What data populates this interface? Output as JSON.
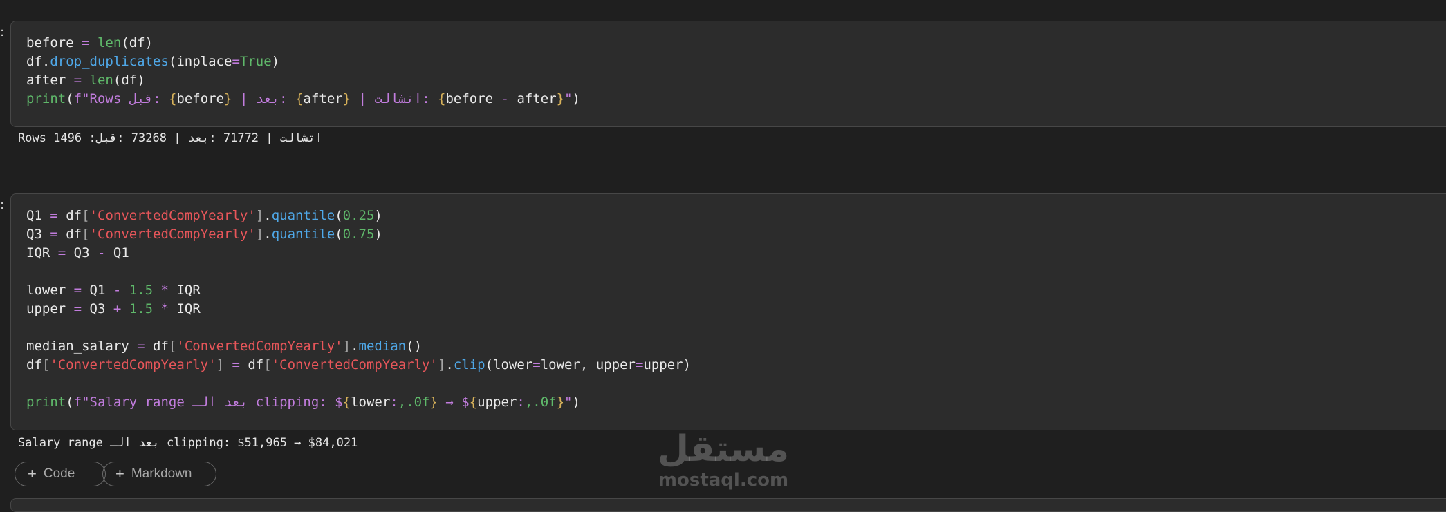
{
  "gutter_mark": ":",
  "cell1": {
    "lines": [
      [
        {
          "c": "n",
          "t": "before "
        },
        {
          "c": "op",
          "t": "="
        },
        {
          "c": "n",
          "t": " "
        },
        {
          "c": "b",
          "t": "len"
        },
        {
          "c": "n",
          "t": "(df)"
        }
      ],
      [
        {
          "c": "n",
          "t": "df."
        },
        {
          "c": "f",
          "t": "drop_duplicates"
        },
        {
          "c": "n",
          "t": "(inplace"
        },
        {
          "c": "op",
          "t": "="
        },
        {
          "c": "b",
          "t": "True"
        },
        {
          "c": "n",
          "t": ")"
        }
      ],
      [
        {
          "c": "n",
          "t": "after "
        },
        {
          "c": "op",
          "t": "="
        },
        {
          "c": "n",
          "t": " "
        },
        {
          "c": "b",
          "t": "len"
        },
        {
          "c": "n",
          "t": "(df)"
        }
      ],
      [
        {
          "c": "b",
          "t": "print"
        },
        {
          "c": "n",
          "t": "("
        },
        {
          "c": "fs",
          "t": "f\"Rows قبل: "
        },
        {
          "c": "br",
          "t": "{"
        },
        {
          "c": "n",
          "t": "before"
        },
        {
          "c": "br",
          "t": "}"
        },
        {
          "c": "fs",
          "t": " | بعد: "
        },
        {
          "c": "br",
          "t": "{"
        },
        {
          "c": "n",
          "t": "after"
        },
        {
          "c": "br",
          "t": "}"
        },
        {
          "c": "fs",
          "t": " | اتشالت: "
        },
        {
          "c": "br",
          "t": "{"
        },
        {
          "c": "n",
          "t": "before "
        },
        {
          "c": "op",
          "t": "-"
        },
        {
          "c": "n",
          "t": " after"
        },
        {
          "c": "br",
          "t": "}"
        },
        {
          "c": "fs",
          "t": "\""
        },
        {
          "c": "n",
          "t": ")"
        }
      ]
    ],
    "output": "Rows 1496 :اتشالت | 71772 :بعد | 73268 :قبل"
  },
  "cell2": {
    "lines": [
      [
        {
          "c": "n",
          "t": "Q1 "
        },
        {
          "c": "op",
          "t": "="
        },
        {
          "c": "n",
          "t": " df"
        },
        {
          "c": "brp",
          "t": "["
        },
        {
          "c": "s",
          "t": "'ConvertedCompYearly'"
        },
        {
          "c": "brp",
          "t": "]"
        },
        {
          "c": "n",
          "t": "."
        },
        {
          "c": "f",
          "t": "quantile"
        },
        {
          "c": "n",
          "t": "("
        },
        {
          "c": "num",
          "t": "0.25"
        },
        {
          "c": "n",
          "t": ")"
        }
      ],
      [
        {
          "c": "n",
          "t": "Q3 "
        },
        {
          "c": "op",
          "t": "="
        },
        {
          "c": "n",
          "t": " df"
        },
        {
          "c": "brp",
          "t": "["
        },
        {
          "c": "s",
          "t": "'ConvertedCompYearly'"
        },
        {
          "c": "brp",
          "t": "]"
        },
        {
          "c": "n",
          "t": "."
        },
        {
          "c": "f",
          "t": "quantile"
        },
        {
          "c": "n",
          "t": "("
        },
        {
          "c": "num",
          "t": "0.75"
        },
        {
          "c": "n",
          "t": ")"
        }
      ],
      [
        {
          "c": "n",
          "t": "IQR "
        },
        {
          "c": "op",
          "t": "="
        },
        {
          "c": "n",
          "t": " Q3 "
        },
        {
          "c": "op",
          "t": "-"
        },
        {
          "c": "n",
          "t": " Q1"
        }
      ],
      [],
      [
        {
          "c": "n",
          "t": "lower "
        },
        {
          "c": "op",
          "t": "="
        },
        {
          "c": "n",
          "t": " Q1 "
        },
        {
          "c": "op",
          "t": "-"
        },
        {
          "c": "n",
          "t": " "
        },
        {
          "c": "num",
          "t": "1.5"
        },
        {
          "c": "n",
          "t": " "
        },
        {
          "c": "op",
          "t": "*"
        },
        {
          "c": "n",
          "t": " IQR"
        }
      ],
      [
        {
          "c": "n",
          "t": "upper "
        },
        {
          "c": "op",
          "t": "="
        },
        {
          "c": "n",
          "t": " Q3 "
        },
        {
          "c": "op",
          "t": "+"
        },
        {
          "c": "n",
          "t": " "
        },
        {
          "c": "num",
          "t": "1.5"
        },
        {
          "c": "n",
          "t": " "
        },
        {
          "c": "op",
          "t": "*"
        },
        {
          "c": "n",
          "t": " IQR"
        }
      ],
      [],
      [
        {
          "c": "n",
          "t": "median_salary "
        },
        {
          "c": "op",
          "t": "="
        },
        {
          "c": "n",
          "t": " df"
        },
        {
          "c": "brp",
          "t": "["
        },
        {
          "c": "s",
          "t": "'ConvertedCompYearly'"
        },
        {
          "c": "brp",
          "t": "]"
        },
        {
          "c": "n",
          "t": "."
        },
        {
          "c": "f",
          "t": "median"
        },
        {
          "c": "n",
          "t": "()"
        }
      ],
      [
        {
          "c": "n",
          "t": "df"
        },
        {
          "c": "brp",
          "t": "["
        },
        {
          "c": "s",
          "t": "'ConvertedCompYearly'"
        },
        {
          "c": "brp",
          "t": "]"
        },
        {
          "c": "n",
          "t": " "
        },
        {
          "c": "op",
          "t": "="
        },
        {
          "c": "n",
          "t": " df"
        },
        {
          "c": "brp",
          "t": "["
        },
        {
          "c": "s",
          "t": "'ConvertedCompYearly'"
        },
        {
          "c": "brp",
          "t": "]"
        },
        {
          "c": "n",
          "t": "."
        },
        {
          "c": "f",
          "t": "clip"
        },
        {
          "c": "n",
          "t": "(lower"
        },
        {
          "c": "op",
          "t": "="
        },
        {
          "c": "n",
          "t": "lower, upper"
        },
        {
          "c": "op",
          "t": "="
        },
        {
          "c": "n",
          "t": "upper)"
        }
      ],
      [],
      [
        {
          "c": "b",
          "t": "print"
        },
        {
          "c": "n",
          "t": "("
        },
        {
          "c": "fs",
          "t": "f\"Salary range بعد الـ clipping: $"
        },
        {
          "c": "br",
          "t": "{"
        },
        {
          "c": "n",
          "t": "lower"
        },
        {
          "c": "fs",
          "t": ":"
        },
        {
          "c": "num",
          "t": ",.0f"
        },
        {
          "c": "br",
          "t": "}"
        },
        {
          "c": "fs",
          "t": " → $"
        },
        {
          "c": "br",
          "t": "{"
        },
        {
          "c": "n",
          "t": "upper"
        },
        {
          "c": "fs",
          "t": ":"
        },
        {
          "c": "num",
          "t": ",.0f"
        },
        {
          "c": "br",
          "t": "}"
        },
        {
          "c": "fs",
          "t": "\""
        },
        {
          "c": "n",
          "t": ")"
        }
      ]
    ],
    "output": "Salary range بعد الـ clipping: $51,965 → $84,021"
  },
  "toolbar": {
    "add_code_label": "Code",
    "add_markdown_label": "Markdown",
    "plus_glyph": "+"
  },
  "watermark": {
    "arabic": "مستقل",
    "latin": "mostaql.com"
  }
}
